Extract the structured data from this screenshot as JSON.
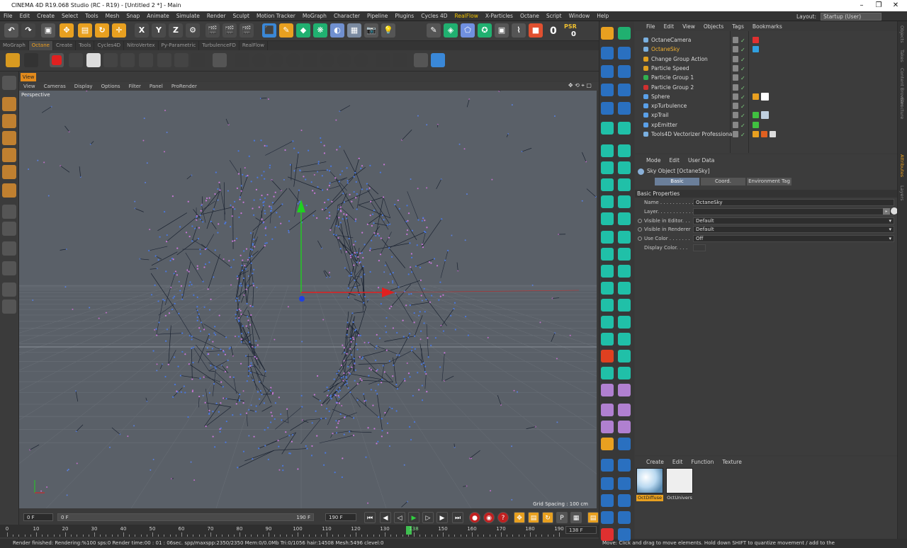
{
  "window": {
    "title": "CINEMA 4D R19.068 Studio (RC - R19) - [Untitled 2 *] - Main",
    "controls": {
      "minimize": "–",
      "maximize": "❐",
      "close": "✕"
    }
  },
  "menubar": {
    "items": [
      "File",
      "Edit",
      "Create",
      "Select",
      "Tools",
      "Mesh",
      "Snap",
      "Animate",
      "Simulate",
      "Render",
      "Sculpt",
      "Motion Tracker",
      "MoGraph",
      "Character",
      "Pipeline",
      "Plugins",
      "Cycles 4D",
      "RealFlow",
      "X-Particles",
      "Octane",
      "Script",
      "Window",
      "Help"
    ],
    "highlight": "RealFlow",
    "layout_label": "Layout:",
    "layout_value": "Startup (User)"
  },
  "tabs": {
    "items": [
      "MoGraph",
      "Octane",
      "Create",
      "Tools",
      "Cycles4D",
      "NitroVertex",
      "Py-Parametric",
      "TurbulenceFD",
      "RealFlow"
    ],
    "active": "Octane"
  },
  "toolbar": {
    "psr_label": "PSR",
    "psr_value": "0",
    "lock_value": "0"
  },
  "viewport": {
    "tab": "View",
    "menu": [
      "View",
      "Cameras",
      "Display",
      "Options",
      "Filter",
      "Panel",
      "ProRender"
    ],
    "label": "Perspective",
    "grid_spacing": "Grid Spacing : 100 cm"
  },
  "timeline": {
    "start_field": "0 F",
    "slider_start": "0 F",
    "slider_end": "190 F",
    "end_field": "190 F",
    "current_frame": "138 F",
    "current_marker": "138",
    "ticks": [
      "0",
      "10",
      "20",
      "30",
      "40",
      "50",
      "60",
      "70",
      "80",
      "90",
      "100",
      "110",
      "120",
      "130",
      "150",
      "160",
      "170",
      "180",
      "190"
    ]
  },
  "status": {
    "left": "Render finished: Rendering:%100 sps:0 Render time:00 : 01 : 06sec. spp/maxspp:2350/2350 Mem:0/0.0Mb Tri:0/1056 hair:14508 Mesh:5496 clevel:0",
    "right": "Move: Click and drag to move elements. Hold down SHIFT to quantize movement / add to the"
  },
  "objects": {
    "menu": [
      "File",
      "Edit",
      "View",
      "Objects",
      "Tags",
      "Bookmarks"
    ],
    "rows": [
      {
        "name": "OctaneCamera",
        "icon_color": "#7ab0e0",
        "selected": false
      },
      {
        "name": "OctaneSky",
        "icon_color": "#7ab0e0",
        "selected": true
      },
      {
        "name": "Change Group Action",
        "icon_color": "#e0a020",
        "selected": false
      },
      {
        "name": "Particle Speed",
        "icon_color": "#e0a020",
        "selected": false
      },
      {
        "name": "Particle Group 1",
        "icon_color": "#30b050",
        "selected": false
      },
      {
        "name": "Particle Group 2",
        "icon_color": "#d03030",
        "selected": false
      },
      {
        "name": "Sphere",
        "icon_color": "#5aa0e8",
        "selected": false
      },
      {
        "name": "xpTurbulence",
        "icon_color": "#5aa0e8",
        "selected": false
      },
      {
        "name": "xpTrail",
        "icon_color": "#5aa0e8",
        "selected": false
      },
      {
        "name": "xpEmitter",
        "icon_color": "#5aa0e8",
        "selected": false
      },
      {
        "name": "Tools4D Vectorizer Professional",
        "icon_color": "#7ab0e0",
        "selected": false
      }
    ]
  },
  "attributes": {
    "menu": [
      "Mode",
      "Edit",
      "User Data"
    ],
    "title": "Sky Object [OctaneSky]",
    "tabs": [
      "Basic",
      "Coord.",
      "Environment Tag"
    ],
    "active_tab": "Basic",
    "section": "Basic Properties",
    "rows": [
      {
        "label": "Name . . . . . . . . . . .",
        "value": "OctaneSky",
        "radio": false
      },
      {
        "label": "Layer. . . . . . . . . . . .",
        "value": "",
        "radio": false
      },
      {
        "label": "Visible in Editor. . .",
        "value": "Default",
        "radio": true
      },
      {
        "label": "Visible in Renderer",
        "value": "Default",
        "radio": true
      },
      {
        "label": "Use Color . . . . . . .",
        "value": "Off",
        "radio": true
      },
      {
        "label": "Display Color. . . .",
        "value": "",
        "radio": false
      }
    ]
  },
  "materials": {
    "menu": [
      "Create",
      "Edit",
      "Function",
      "Texture"
    ],
    "items": [
      {
        "name": "OctDiffuse",
        "selected": true
      },
      {
        "name": "OctUnivers",
        "selected": false
      }
    ]
  },
  "side_tabs": [
    "Objects",
    "Takes",
    "Content Browser",
    "Structure",
    "Attributes",
    "Layers"
  ],
  "colors": {
    "accent_orange": "#e28a1c",
    "teal_tool": "#20c0a8",
    "viewport_bg": "#5a6068",
    "axis_x": "#e02020",
    "axis_y": "#20d020",
    "axis_z": "#2040e0"
  }
}
